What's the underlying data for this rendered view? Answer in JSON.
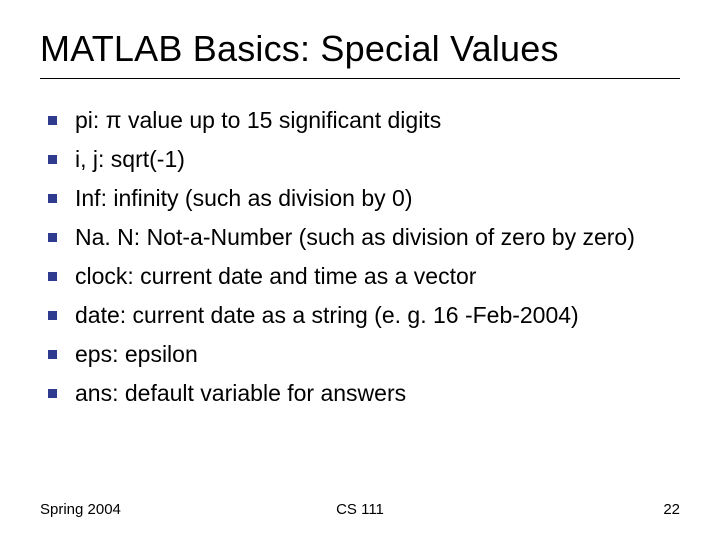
{
  "title": "MATLAB Basics: Special Values",
  "bullets": [
    "pi: π value up to 15 significant digits",
    "i, j: sqrt(-1)",
    "Inf: infinity (such as division by 0)",
    "Na. N: Not-a-Number (such as division of zero by zero)",
    "clock: current date and time as a vector",
    "date: current date as a string (e. g. 16 -Feb-2004)",
    "eps: epsilon",
    "ans: default variable for answers"
  ],
  "footer": {
    "left": "Spring 2004",
    "center": "CS 111",
    "right": "22"
  }
}
